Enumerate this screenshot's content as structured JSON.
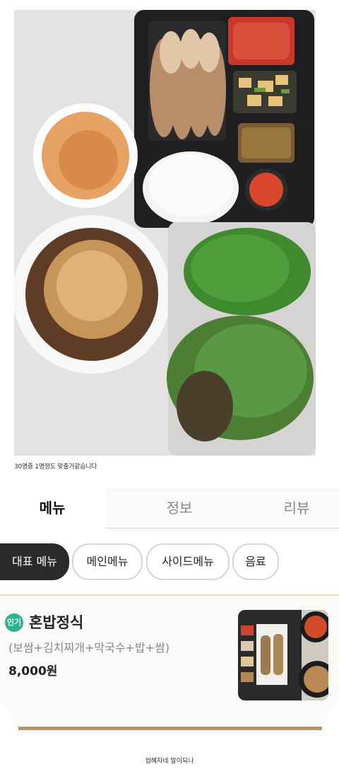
{
  "photo": {
    "caption": "30명중 1명정도 맞출거같습니다"
  },
  "tabs": [
    {
      "label": "메뉴",
      "active": true
    },
    {
      "label": "정보",
      "active": false
    },
    {
      "label": "리뷰",
      "active": false
    }
  ],
  "categories": [
    {
      "label": "대표 메뉴",
      "active": true
    },
    {
      "label": "메인메뉴",
      "active": false
    },
    {
      "label": "사이드메뉴",
      "active": false
    },
    {
      "label": "음료",
      "active": false
    }
  ],
  "menu_item": {
    "badge": "인기",
    "name": "혼밥정식",
    "description": "(보쌈+김치찌개+막국수+밥+쌈)",
    "price": "8,000원"
  },
  "footer_caption": "씹혜자네 말이되나",
  "colors": {
    "badge": "#2db38f",
    "active_chip": "#2b2b2b",
    "card_accent": "#b7975f"
  }
}
